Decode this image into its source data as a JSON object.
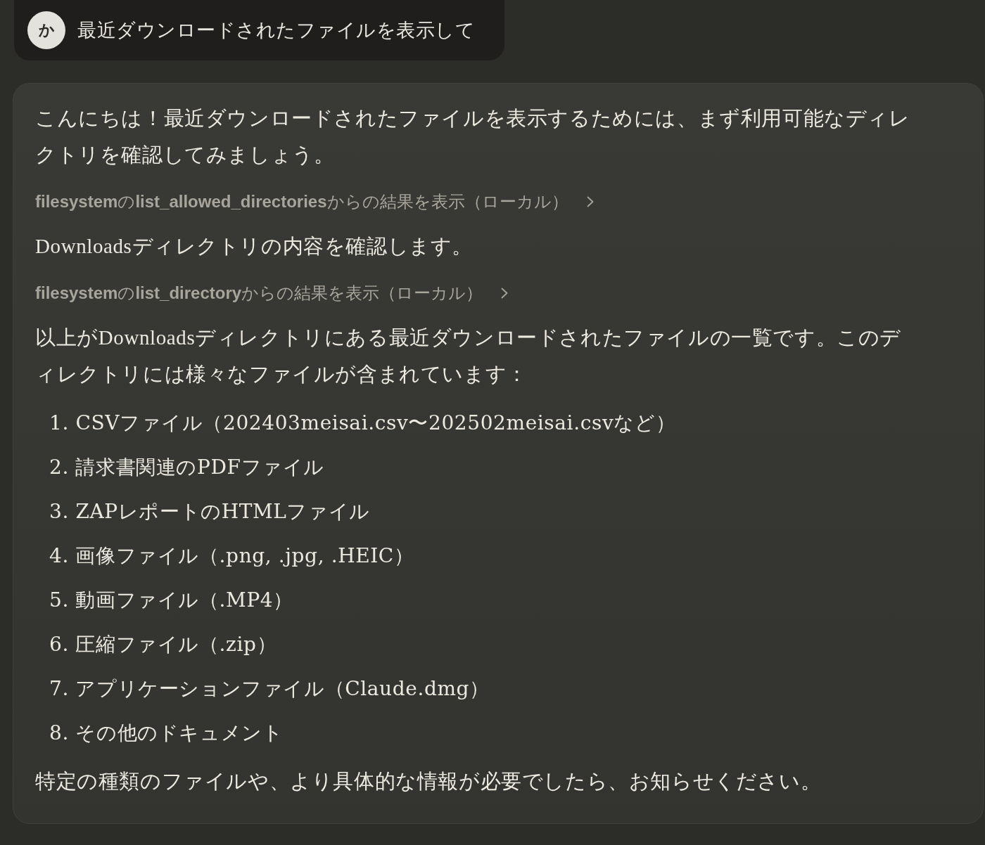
{
  "user_message": {
    "avatar_initial": "か",
    "text": "最近ダウンロードされたファイルを表示して"
  },
  "assistant_message": {
    "blocks": [
      {
        "kind": "paragraph",
        "text": "こんにちは！最近ダウンロードされたファイルを表示するためには、まず利用可能なディレクトリを確認してみましょう。"
      },
      {
        "kind": "tool_result",
        "text": "**filesystem**の**list_allowed_directories**からの結果を表示（ローカル）",
        "expanded": false
      },
      {
        "kind": "paragraph",
        "text": "Downloadsディレクトリの内容を確認します。"
      },
      {
        "kind": "tool_result",
        "text": "**filesystem**の**list_directory**からの結果を表示（ローカル）",
        "expanded": false
      },
      {
        "kind": "paragraph",
        "text": "以上がDownloadsディレクトリにある最近ダウンロードされたファイルの一覧です。このディレクトリには様々なファイルが含まれています："
      },
      {
        "kind": "list",
        "items": [
          "1. CSVファイル（202403meisai.csv〜202502meisai.csvなど）",
          "2. 請求書関連のPDFファイル",
          "3. ZAPレポートのHTMLファイル",
          "4. 画像ファイル（.png, .jpg, .HEIC）",
          "5. 動画ファイル（.MP4）",
          "6. 圧縮ファイル（.zip）",
          "7. アプリケーションファイル（Claude.dmg）",
          "8. その他のドキュメント"
        ]
      },
      {
        "kind": "paragraph",
        "text": "特定の種類のファイルや、より具体的な情報が必要でしたら、お知らせください。"
      }
    ]
  }
}
